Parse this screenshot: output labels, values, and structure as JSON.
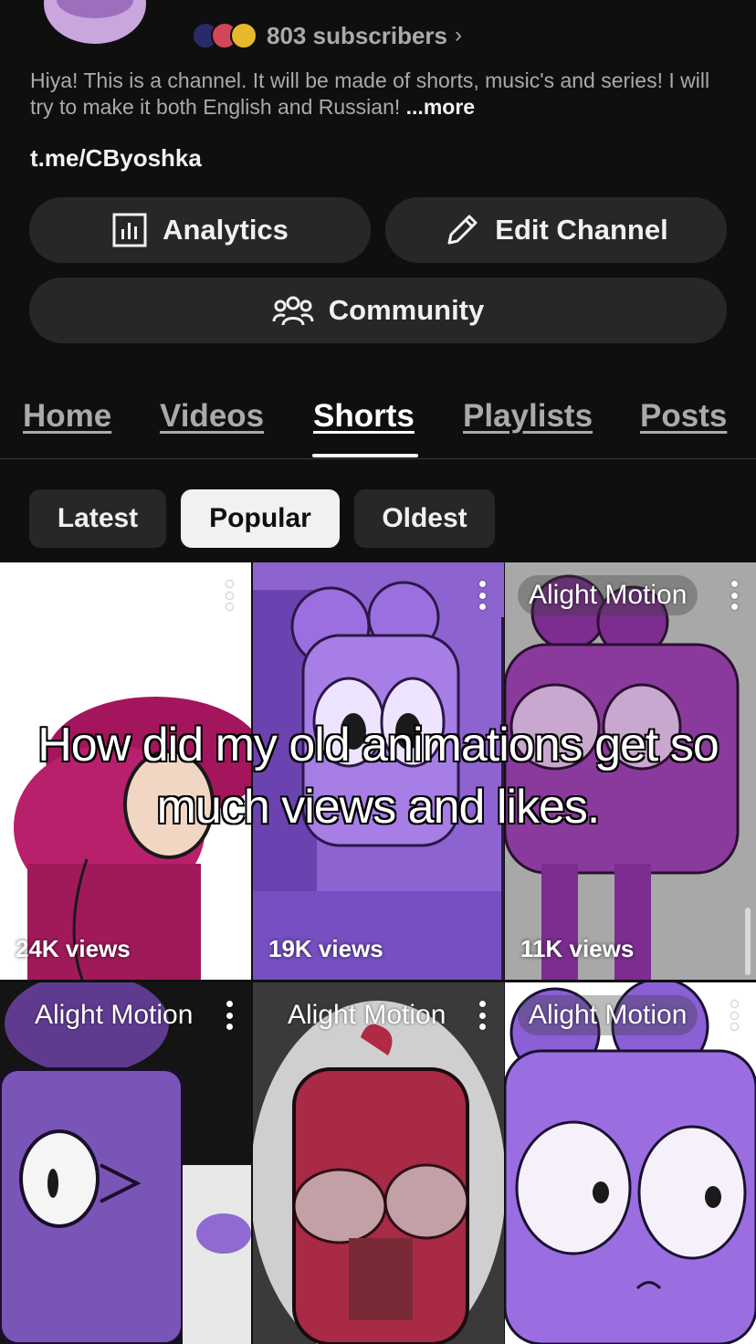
{
  "channel": {
    "subscribers": "803 subscribers",
    "description": "Hiya! This is a channel. It will be made of shorts, music's and series! I will try to make it both English and Russian!",
    "more_label": "...more",
    "link": "t.me/CByoshka"
  },
  "actions": {
    "analytics": "Analytics",
    "edit_channel": "Edit Channel",
    "community": "Community"
  },
  "tabs": [
    {
      "label": "Home",
      "active": false
    },
    {
      "label": "Videos",
      "active": false
    },
    {
      "label": "Shorts",
      "active": true
    },
    {
      "label": "Playlists",
      "active": false
    },
    {
      "label": "Posts",
      "active": false
    }
  ],
  "filters": [
    {
      "label": "Latest",
      "selected": false
    },
    {
      "label": "Popular",
      "selected": true
    },
    {
      "label": "Oldest",
      "selected": false
    }
  ],
  "overlay_caption": "How did my old animations get so much views and likes.",
  "shorts": [
    {
      "views": "24K views",
      "watermark": ""
    },
    {
      "views": "19K views",
      "watermark": ""
    },
    {
      "views": "11K views",
      "watermark": "Alight Motion"
    },
    {
      "views": "",
      "watermark": "Alight Motion"
    },
    {
      "views": "",
      "watermark": "Alight Motion"
    },
    {
      "views": "",
      "watermark": "Alight Motion"
    }
  ],
  "icons": {
    "analytics": "analytics-icon",
    "edit": "pencil-icon",
    "community": "community-icon",
    "menu": "more-vert-icon",
    "chevron": "chevron-right-icon"
  },
  "colors": {
    "background": "#0f0f0f",
    "button": "#272727",
    "text": "#f1f1f1",
    "muted": "#aaaaaa"
  }
}
